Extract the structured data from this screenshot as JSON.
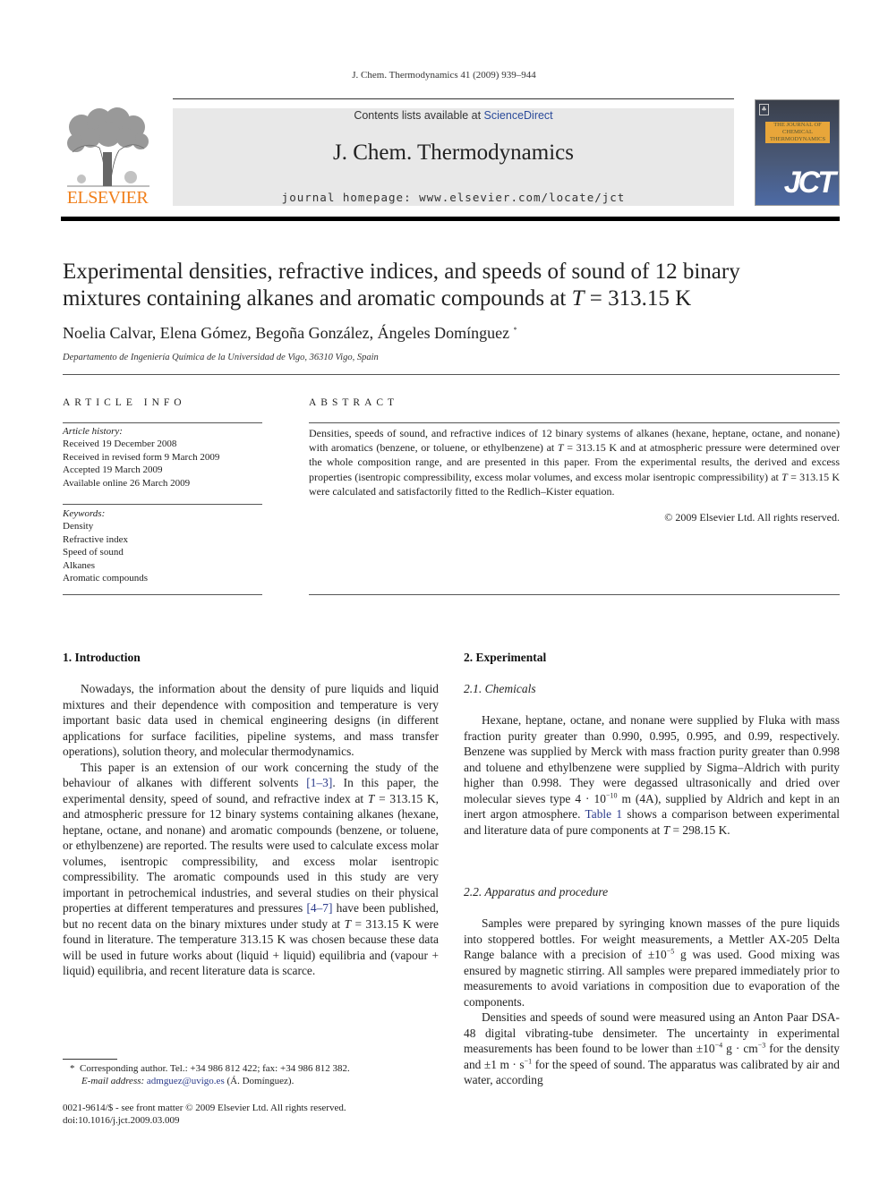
{
  "running_head": "J. Chem. Thermodynamics 41 (2009) 939–944",
  "banner": {
    "contents_prefix": "Contents lists available at ",
    "contents_link": "ScienceDirect",
    "journal_title": "J. Chem. Thermodynamics",
    "homepage": "journal homepage: www.elsevier.com/locate/jct"
  },
  "publisher_logo": {
    "wordmark": "ELSEVIER",
    "icon": "tree-icon",
    "color": "#f07f1b"
  },
  "cover": {
    "label": "THE JOURNAL OF CHEMICAL THERMODYNAMICS",
    "abbrev": "JCT",
    "emblem": "elsevier-emblem-icon"
  },
  "article": {
    "title_line1": "Experimental densities, refractive indices, and speeds of sound of 12 binary",
    "title_line2_pre": "mixtures containing alkanes and aromatic compounds at ",
    "title_line2_var": "T",
    "title_line2_post": " = 313.15 K",
    "authors": "Noelia Calvar, Elena Gómez, Begoña González, Ángeles Domínguez",
    "corresponding_mark": "*",
    "affiliation": "Departamento de Ingeniería Química de la Universidad de Vigo, 36310 Vigo, Spain"
  },
  "article_info": {
    "heading": "ARTICLE INFO",
    "history_label": "Article history:",
    "history": [
      "Received 19 December 2008",
      "Received in revised form 9 March 2009",
      "Accepted 19 March 2009",
      "Available online 26 March 2009"
    ],
    "keywords_label": "Keywords:",
    "keywords": [
      "Density",
      "Refractive index",
      "Speed of sound",
      "Alkanes",
      "Aromatic compounds"
    ]
  },
  "abstract": {
    "heading": "ABSTRACT",
    "p1": "Densities, speeds of sound, and refractive indices of 12 binary systems of alkanes (hexane, heptane, octane, and nonane) with aromatics (benzene, or toluene, or ethylbenzene) at ",
    "p2": " = 313.15 K and at atmospheric pressure were determined over the whole composition range, and are presented in this paper. From the experimental results, the derived and excess properties (isentropic compressibility, excess molar volumes, and excess molar isentropic compressibility) at ",
    "p3": " = 313.15 K were calculated and satisfactorily fitted to the Redlich–Kister equation.",
    "var": "T",
    "copyright": "© 2009 Elsevier Ltd. All rights reserved."
  },
  "intro": {
    "heading": "1. Introduction",
    "p1": "Nowadays, the information about the density of pure liquids and liquid mixtures and their dependence with composition and temperature is very important basic data used in chemical engineering designs (in different applications for surface facilities, pipeline systems, and mass transfer operations), solution theory, and molecular thermodynamics.",
    "p2a": "This paper is an extension of our work concerning the study of the behaviour of alkanes with different solvents ",
    "ref1": "[1–3]",
    "p2b": ". In this paper, the experimental density, speed of sound, and refractive index at ",
    "p2c": " = 313.15 K, and atmospheric pressure for 12 binary systems containing alkanes (hexane, heptane, octane, and nonane) and aromatic compounds (benzene, or toluene, or ethylbenzene) are reported. The results were used to calculate excess molar volumes, isentropic compressibility, and excess molar isentropic compressibility. The aromatic compounds used in this study are very important in petrochemical industries, and several studies on their physical properties at different temperatures and pressures ",
    "ref2": "[4–7]",
    "p2d": " have been published, but no recent data on the binary mixtures under study at ",
    "p2e": " = 313.15 K were found in literature. The temperature 313.15 K was chosen because these data will be used in future works about (liquid + liquid) equilibria and (vapour + liquid) equilibria, and recent literature data is scarce.",
    "var": "T"
  },
  "experimental": {
    "heading": "2. Experimental",
    "sub1": "2.1. Chemicals",
    "chem_a": "Hexane, heptane, octane, and nonane were supplied by Fluka with mass fraction purity greater than 0.990, 0.995, 0.995, and 0.99, respectively. Benzene was supplied by Merck with mass fraction purity greater than 0.998 and toluene and ethylbenzene were supplied by Sigma–Aldrich with purity higher than 0.998. They were degassed ultrasonically and dried over molecular sieves type 4 · 10",
    "chem_exp": "−10",
    "chem_b": " m (4A), supplied by Aldrich and kept in an inert argon atmosphere. ",
    "table_ref": "Table 1",
    "chem_c": " shows a comparison between experimental and literature data of pure components at ",
    "chem_d": " = 298.15 K.",
    "var": "T",
    "sub2": "2.2. Apparatus and procedure",
    "app1a": "Samples were prepared by syringing known masses of the pure liquids into stoppered bottles. For weight measurements, a Mettler AX-205 Delta Range balance with a precision of ±10",
    "app1_exp": "−5",
    "app1b": " g was used. Good mixing was ensured by magnetic stirring. All samples were prepared immediately prior to measurements to avoid variations in composition due to evaporation of the components.",
    "app2a": "Densities and speeds of sound were measured using an Anton Paar DSA-48 digital vibrating-tube densimeter. The uncertainty in experimental measurements has been found to be lower than ±10",
    "app2_exp1": "−4",
    "app2b": " g · cm",
    "app2_exp2": "−3",
    "app2c": " for the density and ±1 m · s",
    "app2_exp3": "−1",
    "app2d": " for the speed of sound. The apparatus was calibrated by air and water, according"
  },
  "footnote": {
    "mark": "*",
    "line1": "Corresponding author. Tel.: +34 986 812 422; fax: +34 986 812 382.",
    "email_label": "E-mail address: ",
    "email": "admguez@uvigo.es",
    "email_suffix": " (Á. Domínguez).",
    "issn": "0021-9614/$ - see front matter © 2009 Elsevier Ltd. All rights reserved.",
    "doi": "doi:10.1016/j.jct.2009.03.009"
  }
}
